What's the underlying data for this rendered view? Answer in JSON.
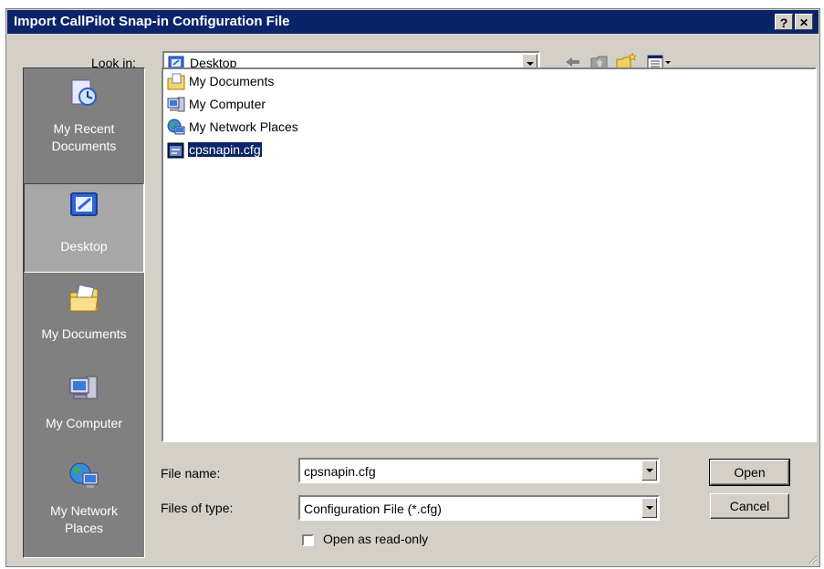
{
  "window": {
    "title": "Import CallPilot Snap-in Configuration File",
    "help_glyph": "?",
    "close_glyph": "✕"
  },
  "look_in": {
    "label": "Look in:",
    "value": "Desktop"
  },
  "toolbar": {
    "icons": [
      "back-arrow-icon",
      "up-folder-icon",
      "new-folder-icon",
      "views-menu-icon"
    ]
  },
  "places": [
    {
      "label_line1": "My Recent",
      "label_line2": "Documents",
      "icon": "recent-documents-icon",
      "selected": false
    },
    {
      "label_line1": "Desktop",
      "label_line2": "",
      "icon": "desktop-icon",
      "selected": true
    },
    {
      "label_line1": "My Documents",
      "label_line2": "",
      "icon": "my-documents-icon",
      "selected": false
    },
    {
      "label_line1": "My Computer",
      "label_line2": "",
      "icon": "my-computer-icon",
      "selected": false
    },
    {
      "label_line1": "My Network",
      "label_line2": "Places",
      "icon": "network-places-icon",
      "selected": false
    }
  ],
  "files": [
    {
      "name": "My Documents",
      "icon": "folder-documents-icon"
    },
    {
      "name": "My Computer",
      "icon": "computer-icon"
    },
    {
      "name": "My Network Places",
      "icon": "network-icon"
    },
    {
      "name": "cpsnapin.cfg",
      "icon": "config-file-icon",
      "selected": true
    }
  ],
  "filename": {
    "label": "File name:",
    "value": "cpsnapin.cfg"
  },
  "filetype": {
    "label": "Files of type:",
    "value": "Configuration File (*.cfg)"
  },
  "readonly": {
    "label": "Open as read-only",
    "checked": false
  },
  "buttons": {
    "open": "Open",
    "cancel": "Cancel"
  },
  "colors": {
    "titlebar": "#0a246a",
    "face": "#d4d0c8",
    "places_bg": "#808080",
    "selection": "#0a246a"
  }
}
